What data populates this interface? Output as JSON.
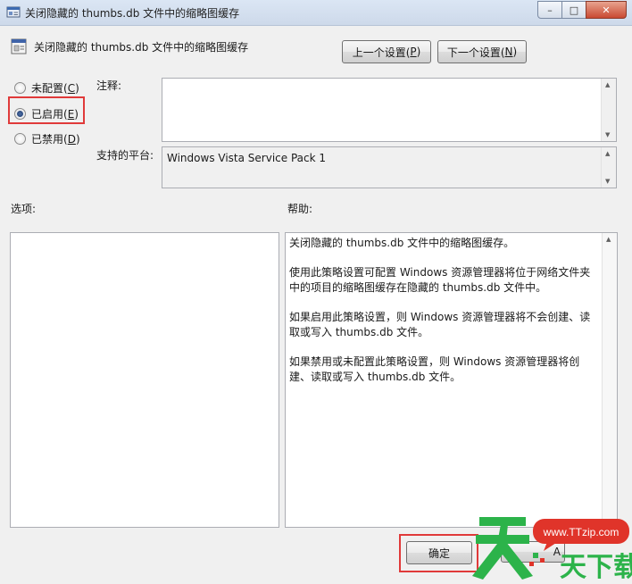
{
  "window": {
    "title": "关闭隐藏的 thumbs.db 文件中的缩略图缓存",
    "controls": {
      "minimize": "–",
      "maximize": "□",
      "close": "✕"
    }
  },
  "header": {
    "policy_name": "关闭隐藏的 thumbs.db 文件中的缩略图缓存",
    "prev_button": {
      "text": "上一个设置(",
      "key": "P",
      "end": ")"
    },
    "next_button": {
      "text": "下一个设置(",
      "key": "N",
      "end": ")"
    }
  },
  "state": {
    "not_configured": {
      "text": "未配置(",
      "key": "C",
      "end": ")"
    },
    "enabled": {
      "text": "已启用(",
      "key": "E",
      "end": ")"
    },
    "disabled": {
      "text": "已禁用(",
      "key": "D",
      "end": ")"
    },
    "selected": "enabled"
  },
  "labels": {
    "comment": "注释:",
    "platform": "支持的平台:",
    "options": "选项:",
    "help": "帮助:"
  },
  "comment_value": "",
  "platform_value": "Windows Vista Service Pack 1",
  "help_paragraphs": [
    "关闭隐藏的 thumbs.db 文件中的缩略图缓存。",
    "使用此策略设置可配置 Windows 资源管理器将位于网络文件夹中的项目的缩略图缓存在隐藏的 thumbs.db 文件中。",
    "如果启用此策略设置，则 Windows 资源管理器将不会创建、读取或写入 thumbs.db 文件。",
    "如果禁用或未配置此策略设置，则 Windows 资源管理器将创建、读取或写入 thumbs.db 文件。"
  ],
  "footer": {
    "ok_label": "确定",
    "partial_button_label": "A"
  },
  "watermark": {
    "url": "www.TTzip.com",
    "brand": "天下载"
  },
  "colors": {
    "highlight_box": "#e03a3a",
    "watermark_green": "#2cb34a",
    "watermark_red": "#e0342a"
  }
}
